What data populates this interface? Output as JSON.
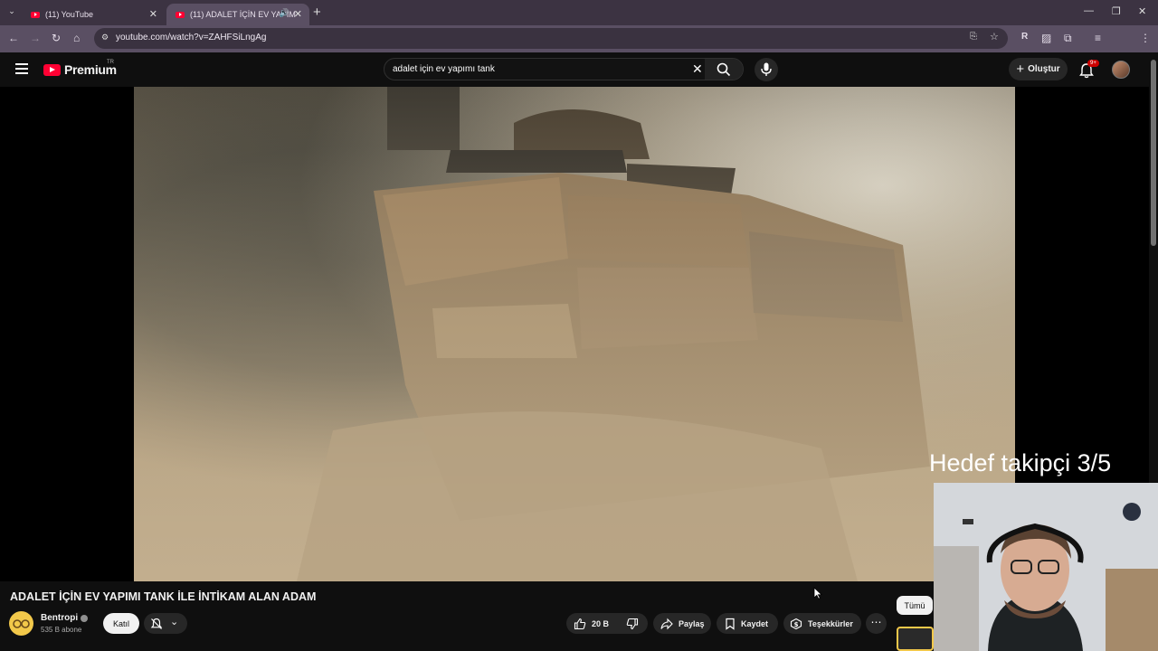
{
  "browser": {
    "tabs": [
      {
        "title": "(11) YouTube"
      },
      {
        "title": "(11) ADALET İÇİN EV YAPIM"
      }
    ],
    "url": "youtube.com/watch?v=ZAHFSiLngAg"
  },
  "masthead": {
    "logo_text": "Premium",
    "country_code": "TR",
    "search_value": "adalet için ev yapımı tank",
    "create_label": "Oluştur",
    "notification_badge": "9+"
  },
  "overlay": {
    "goal_text": "Hedef takipçi 3/5"
  },
  "video": {
    "title": "ADALET İÇİN EV YAPIMI TANK İLE İNTİKAM ALAN ADAM",
    "channel_name": "Bentropi",
    "subscribers": "535 B abone",
    "join_label": "Katıl",
    "like_count": "20 B",
    "share_label": "Paylaş",
    "save_label": "Kaydet",
    "thanks_label": "Teşekkürler"
  },
  "sidebar": {
    "chip_all": "Tümü"
  },
  "colors": {
    "brand_red": "#ff0033",
    "tab_strip": "#3c3342",
    "toolbar": "#5a4f63",
    "background": "#0f0f0f",
    "pill": "#272727"
  }
}
